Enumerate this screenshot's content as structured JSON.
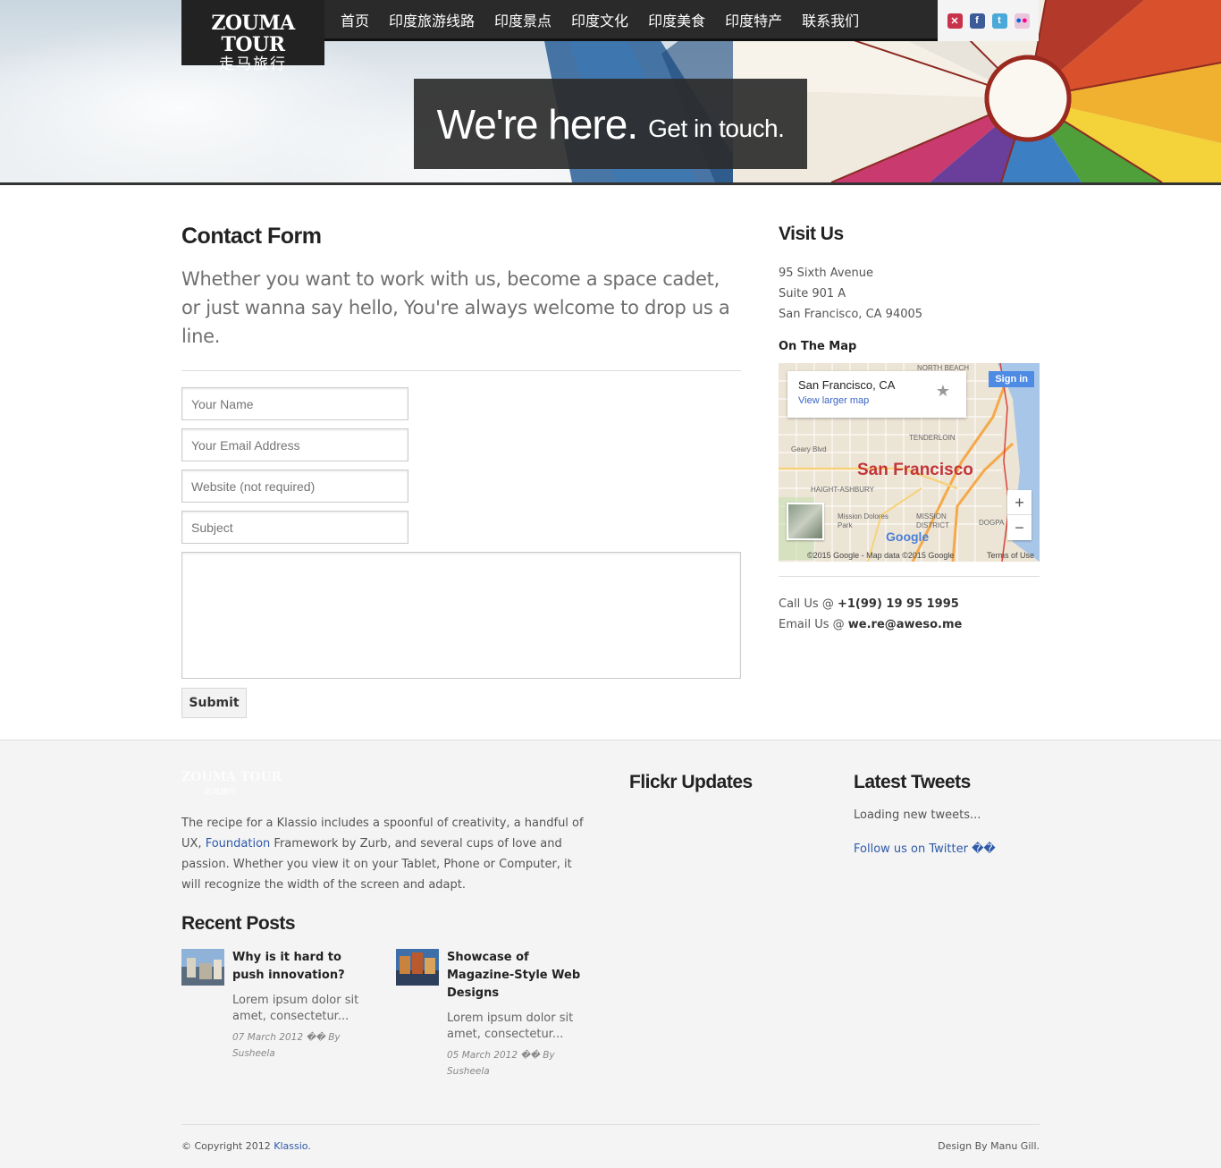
{
  "header": {
    "logo_en": "ZOUMA TOUR",
    "logo_cn": "走马旅行",
    "nav": [
      "首页",
      "印度旅游线路",
      "印度景点",
      "印度文化",
      "印度美食",
      "印度特产",
      "联系我们"
    ],
    "social_icons": [
      "uk-flag-icon",
      "facebook-icon",
      "twitter-icon",
      "flickr-icon"
    ],
    "tagline_big": "We're here.",
    "tagline_small": "Get in touch."
  },
  "contact": {
    "title": "Contact Form",
    "intro": "Whether you want to work with us, become a space cadet, or just wanna say hello, You're always welcome to drop us a line.",
    "fields": {
      "name_placeholder": "Your Name",
      "email_placeholder": "Your Email Address",
      "website_placeholder": "Website (not required)",
      "subject_placeholder": "Subject",
      "message_value": ""
    },
    "submit_label": "Submit"
  },
  "visit": {
    "title": "Visit Us",
    "address": [
      "95 Sixth Avenue",
      "Suite 901 A",
      "San Francisco, CA 94005"
    ],
    "map_title": "On The Map",
    "map": {
      "place": "San Francisco, CA",
      "larger_link": "View larger map",
      "signin": "Sign in",
      "city_label": "San Francisco",
      "zoom_in": "+",
      "zoom_out": "−",
      "google": "Google",
      "copyright": "©2015 Google - Map data ©2015 Google",
      "terms": "Terms of Use",
      "streets": [
        "NORTH BEACH",
        "Geary Blvd",
        "TENDERLOIN",
        "HAIGHT-ASHBURY",
        "Mission Dolores Park",
        "MISSION DISTRICT",
        "DOGPA"
      ]
    },
    "call_label": "Call Us @",
    "call_value": "+1(99) 19 95 1995",
    "email_label": "Email Us @",
    "email_value": "we.re@aweso.me"
  },
  "footer": {
    "logo_en": "ZOUMA TOUR",
    "logo_cn": "走马旅行",
    "about_pre": "The recipe for a Klassio includes a spoonful of creativity, a handful of UX,",
    "about_link": "Foundation",
    "about_post": "Framework by Zurb, and several cups of love and passion. Whether you view it on your Tablet, Phone or Computer, it will recognize the width of the screen and adapt.",
    "recent_title": "Recent Posts",
    "posts": [
      {
        "title": "Why is it hard to push innovation?",
        "excerpt": "Lorem ipsum dolor sit amet, consectetur...",
        "meta": "07 March 2012 �� By Susheela"
      },
      {
        "title": "Showcase of Magazine-Style Web Designs",
        "excerpt": "Lorem ipsum dolor sit amet, consectetur...",
        "meta": "05 March 2012 �� By Susheela"
      }
    ],
    "flickr_title": "Flickr Updates",
    "tweets_title": "Latest Tweets",
    "tweets_loading": "Loading new tweets...",
    "tweets_follow": "Follow us on Twitter ��",
    "copyright_pre": "© Copyright 2012",
    "copyright_link": "Klassio.",
    "design_credit": "Design By Manu Gill."
  }
}
